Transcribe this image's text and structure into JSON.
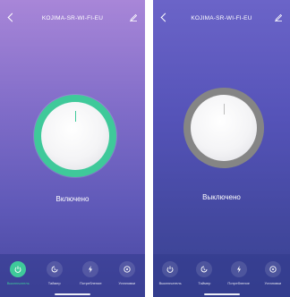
{
  "screens": [
    {
      "title": "KOJIMA-SR-WI-FI-EU",
      "state": "Включено",
      "ring_color": "#3fc99a",
      "nav": [
        "Выключатель",
        "Таймер",
        "Потребление",
        "Установки"
      ],
      "active_nav": 0
    },
    {
      "title": "KOJIMA-SR-WI-FI-EU",
      "state": "Выключено",
      "ring_color": "#858585",
      "nav": [
        "Выключатель",
        "Таймер",
        "Потребление",
        "Установки"
      ],
      "active_nav": null
    }
  ],
  "icons": {
    "back": "chevron-left-icon",
    "edit": "pencil-icon",
    "nav": [
      "power-icon",
      "timer-icon",
      "lightning-icon",
      "settings-icon"
    ]
  },
  "colors": {
    "accent": "#3fc99a",
    "inactive_ring": "#858585"
  }
}
